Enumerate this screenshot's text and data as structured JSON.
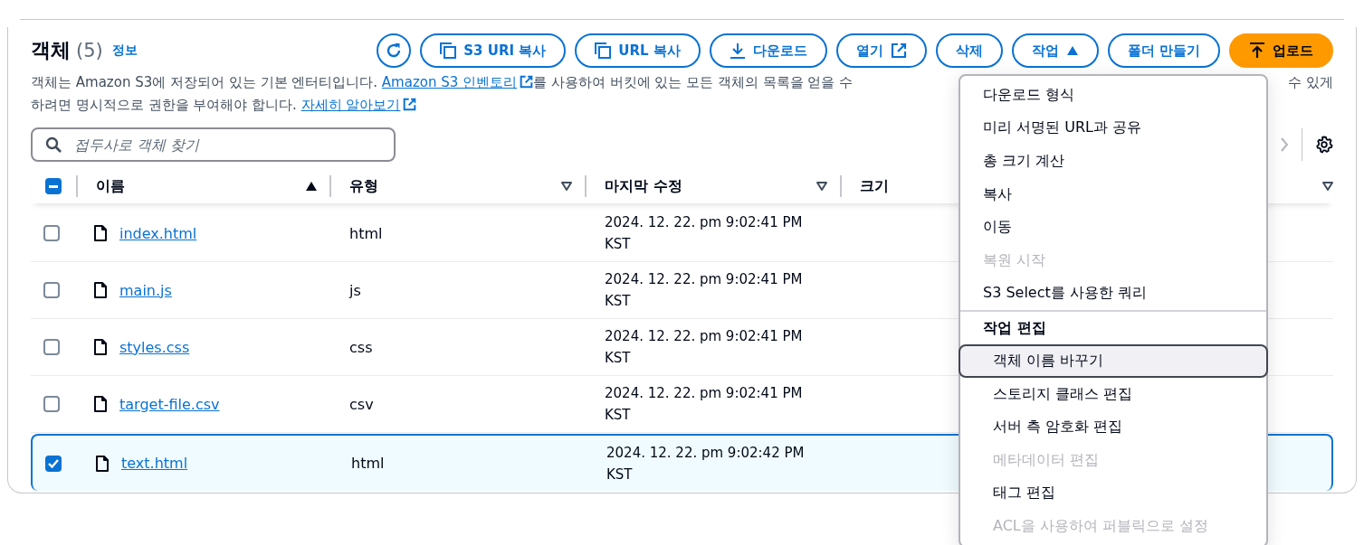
{
  "header": {
    "title": "객체",
    "count": "(5)",
    "info_link": "정보"
  },
  "actions": [
    {
      "kind": "refresh"
    },
    {
      "label": "S3 URI 복사",
      "kind": "copy"
    },
    {
      "label": "URL 복사",
      "kind": "copy"
    },
    {
      "label": "다운로드",
      "kind": "download"
    },
    {
      "label": "열기",
      "kind": "external"
    },
    {
      "label": "삭제",
      "kind": "plain"
    },
    {
      "label": "작업",
      "kind": "dropdown",
      "expanded": true
    },
    {
      "label": "폴더 만들기",
      "kind": "plain"
    },
    {
      "label": "업로드",
      "kind": "primary"
    }
  ],
  "description": {
    "text_1": "객체는 Amazon S3에 저장되어 있는 기본 엔터티입니다.",
    "link_1": "Amazon S3 인벤토리",
    "text_2": "를 사용하여 버킷에 있는 모든 객체의 목록을 얻을 수",
    "text_3": "수 있게",
    "text_4": "하려면 명시적으로 권한을 부여해야 합니다.",
    "link_2": "자세히 알아보기"
  },
  "search": {
    "placeholder": "접두사로 객체 찾기"
  },
  "table": {
    "select_all": {
      "indeterminate": true
    },
    "columns": [
      {
        "label": "이름",
        "sorted": true
      },
      {
        "label": "유형",
        "sorted": false
      },
      {
        "label": "마지막 수정",
        "sorted": false
      },
      {
        "label": "크기"
      },
      {
        "sorted": false
      }
    ],
    "rows": [
      {
        "name": "index.html",
        "type": "html",
        "modified": "2024. 12. 22. pm 9:02:41 PM KST",
        "selected": false
      },
      {
        "name": "main.js",
        "type": "js",
        "modified": "2024. 12. 22. pm 9:02:41 PM KST",
        "selected": false
      },
      {
        "name": "styles.css",
        "type": "css",
        "modified": "2024. 12. 22. pm 9:02:41 PM KST",
        "selected": false
      },
      {
        "name": "target-file.csv",
        "type": "csv",
        "modified": "2024. 12. 22. pm 9:02:41 PM KST",
        "selected": false
      },
      {
        "name": "text.html",
        "type": "html",
        "modified": "2024. 12. 22. pm 9:02:42 PM KST",
        "selected": true
      }
    ]
  },
  "menu": {
    "items": [
      {
        "kind": "item",
        "label": "다운로드 형식",
        "disabled": false,
        "highlighted": false
      },
      {
        "kind": "item",
        "label": "미리 서명된 URL과 공유",
        "disabled": false,
        "highlighted": false
      },
      {
        "kind": "item",
        "label": "총 크기 계산",
        "disabled": false,
        "highlighted": false
      },
      {
        "kind": "item",
        "label": "복사",
        "disabled": false,
        "highlighted": false
      },
      {
        "kind": "item",
        "label": "이동",
        "disabled": false,
        "highlighted": false
      },
      {
        "kind": "item",
        "label": "복원 시작",
        "disabled": true,
        "highlighted": false
      },
      {
        "kind": "item",
        "label": "S3 Select를 사용한 쿼리",
        "disabled": false,
        "highlighted": false
      },
      {
        "kind": "group",
        "label": "작업 편집",
        "children": [
          {
            "kind": "item",
            "label": "객체 이름 바꾸기",
            "disabled": false,
            "highlighted": true
          },
          {
            "kind": "item",
            "label": "스토리지 클래스 편집",
            "disabled": false,
            "highlighted": false
          },
          {
            "kind": "item",
            "label": "서버 측 암호화 편집",
            "disabled": false,
            "highlighted": false
          },
          {
            "kind": "item",
            "label": "메타데이터 편집",
            "disabled": true,
            "highlighted": false
          },
          {
            "kind": "item",
            "label": "태그 편집",
            "disabled": false,
            "highlighted": false
          },
          {
            "kind": "item",
            "label": "ACL을 사용하여 퍼블릭으로 설정",
            "disabled": true,
            "highlighted": false
          }
        ]
      }
    ]
  }
}
